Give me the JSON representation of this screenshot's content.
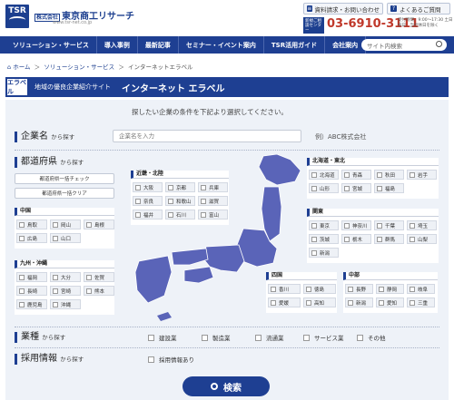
{
  "header": {
    "logo": "TSR",
    "brand_prefix": "株式会社",
    "brand": "東京商工リサーチ",
    "url": "www.tsr-net.co.jp",
    "btn_request": "資料請求・お問い合わせ",
    "btn_faq": "よくあるご質問",
    "phone_label": "新規ご相談センター",
    "phone": "03-6910-3111",
    "hours": "受付時間：9:00～17:30 土日祝日、当社休日を除く"
  },
  "nav": {
    "items": [
      "ソリューション・サービス",
      "導入事例",
      "最新記事",
      "セミナー・イベント案内",
      "TSR活用ガイド",
      "会社案内"
    ],
    "search_placeholder": "サイト内検索"
  },
  "breadcrumb": {
    "home": "ホーム",
    "sep": "＞",
    "level1": "ソリューション・サービス",
    "current": "インターネットエラベル"
  },
  "banner": {
    "logo": "エラベル",
    "subtitle": "地域の優良企業紹介サイト",
    "title": "インターネット エラベル"
  },
  "form": {
    "intro": "探したい企業の条件を下記より選択してください。",
    "company": {
      "label": "企業名",
      "suffix": "から探す",
      "placeholder": "企業名を入力",
      "example": "例）ABC株式会社"
    },
    "pref": {
      "label": "都道府県",
      "suffix": "から探す",
      "btn_all": "都道府県一括チェック",
      "btn_clear": "都道府県一括クリア"
    },
    "regions": [
      {
        "name": "中国",
        "prefs": [
          "鳥取",
          "岡山",
          "島根",
          "広島",
          "山口"
        ]
      },
      {
        "name": "九州・沖縄",
        "prefs": [
          "福岡",
          "大分",
          "佐賀",
          "長崎",
          "宮崎",
          "熊本",
          "鹿児島",
          "沖縄"
        ]
      },
      {
        "name": "近畿・北陸",
        "prefs": [
          "大阪",
          "京都",
          "兵庫",
          "奈良",
          "和歌山",
          "滋賀",
          "福井",
          "石川",
          "富山"
        ]
      },
      {
        "name": "四国",
        "prefs": [
          "香川",
          "徳島",
          "愛媛",
          "高知"
        ]
      },
      {
        "name": "中部",
        "prefs": [
          "長野",
          "静岡",
          "岐阜",
          "新潟",
          "愛知",
          "三重"
        ]
      },
      {
        "name": "北海道・東北",
        "prefs": [
          "北海道",
          "青森",
          "秋田",
          "岩手",
          "山形",
          "宮城",
          "福島"
        ]
      },
      {
        "name": "関東",
        "prefs": [
          "東京",
          "神奈川",
          "千葉",
          "埼玉",
          "茨城",
          "栃木",
          "群馬",
          "山梨",
          "新潟"
        ]
      }
    ],
    "industry": {
      "label": "業種",
      "suffix": "から探す",
      "options": [
        "建設業",
        "製造業",
        "流通業",
        "サービス業",
        "その他"
      ]
    },
    "recruit": {
      "label": "採用情報",
      "suffix": "から探す",
      "option": "採用情報あり"
    },
    "search_button": "検索"
  },
  "colors": {
    "primary": "#1e3f92",
    "phone": "#c0392b",
    "map": "#5a64b8",
    "panel": "#eef2f8"
  }
}
